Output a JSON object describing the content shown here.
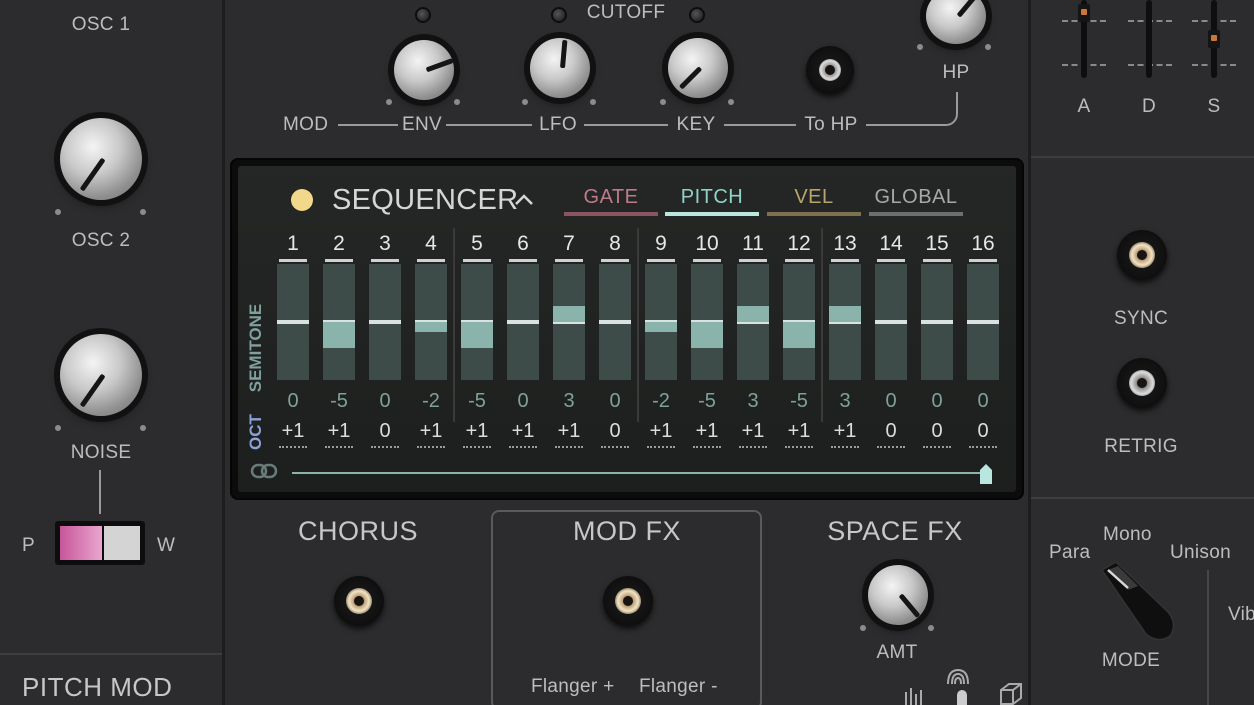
{
  "osc": {
    "osc1_label": "OSC 1",
    "osc2_label": "OSC 2",
    "noise_label": "NOISE"
  },
  "pw_switch": {
    "left": "P",
    "right": "W"
  },
  "pitch_mod": {
    "label": "PITCH MOD"
  },
  "filter": {
    "cutoff_label": "CUTOFF",
    "mod_label": "MOD",
    "env_label": "ENV",
    "lfo_label": "LFO",
    "key_label": "KEY",
    "to_hp_label": "To HP",
    "hp_label": "HP"
  },
  "envelope": {
    "a": "A",
    "d": "D",
    "s": "S"
  },
  "sync": {
    "sync_label": "SYNC",
    "retrig_label": "RETRIG"
  },
  "sequencer": {
    "title": "SEQUENCER",
    "status_color": "#f2d88a",
    "tabs": [
      {
        "label": "GATE",
        "color": "#c07a88",
        "active": false
      },
      {
        "label": "PITCH",
        "color": "#8fd3c8",
        "active": true
      },
      {
        "label": "VEL",
        "color": "#b9a56a",
        "active": false
      },
      {
        "label": "GLOBAL",
        "color": "#a8a8a8",
        "active": false
      }
    ],
    "semitone_label": "SEMITONE",
    "oct_label": "OCT",
    "steps": [
      {
        "num": "1",
        "semi": "0",
        "oct": "+1"
      },
      {
        "num": "2",
        "semi": "-5",
        "oct": "+1"
      },
      {
        "num": "3",
        "semi": "0",
        "oct": "0"
      },
      {
        "num": "4",
        "semi": "-2",
        "oct": "+1"
      },
      {
        "num": "5",
        "semi": "-5",
        "oct": "+1"
      },
      {
        "num": "6",
        "semi": "0",
        "oct": "+1"
      },
      {
        "num": "7",
        "semi": "3",
        "oct": "+1"
      },
      {
        "num": "8",
        "semi": "0",
        "oct": "0"
      },
      {
        "num": "9",
        "semi": "-2",
        "oct": "+1"
      },
      {
        "num": "10",
        "semi": "-5",
        "oct": "+1"
      },
      {
        "num": "11",
        "semi": "3",
        "oct": "+1"
      },
      {
        "num": "12",
        "semi": "-5",
        "oct": "+1"
      },
      {
        "num": "13",
        "semi": "3",
        "oct": "+1"
      },
      {
        "num": "14",
        "semi": "0",
        "oct": "0"
      },
      {
        "num": "15",
        "semi": "0",
        "oct": "0"
      },
      {
        "num": "16",
        "semi": "0",
        "oct": "0"
      }
    ]
  },
  "effects": {
    "chorus_label": "CHORUS",
    "modfx_label": "MOD FX",
    "flanger_plus": "Flanger +",
    "flanger_minus": "Flanger -",
    "spacefx_label": "SPACE FX",
    "amt_label": "AMT"
  },
  "voice_mode": {
    "para": "Para",
    "mono": "Mono",
    "unison": "Unison",
    "mode_label": "MODE",
    "vib_partial": "Vib"
  }
}
